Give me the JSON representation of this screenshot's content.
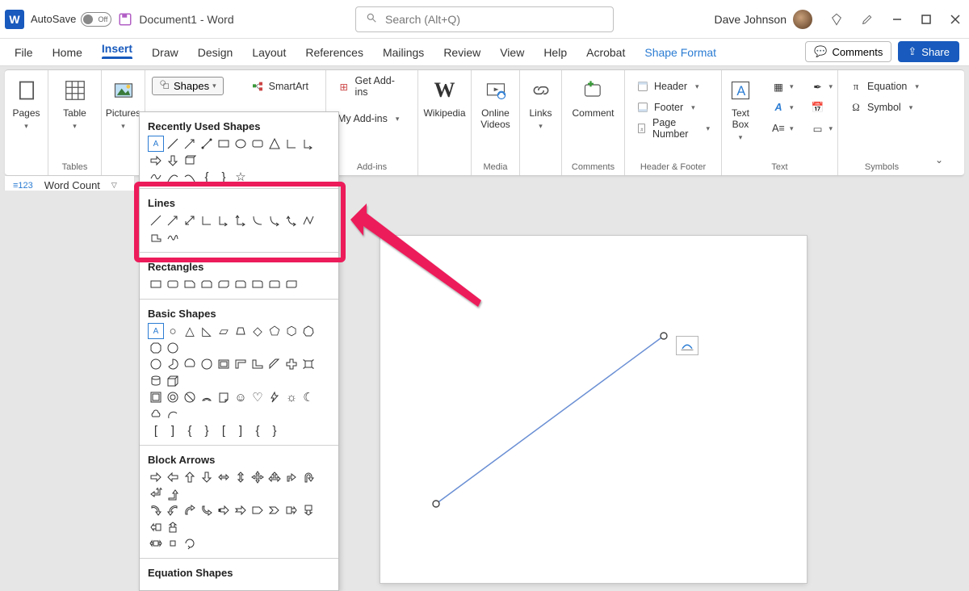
{
  "titlebar": {
    "autosave_label": "AutoSave",
    "autosave_state": "Off",
    "document_title": "Document1  -  Word",
    "search_placeholder": "Search (Alt+Q)",
    "user_name": "Dave Johnson"
  },
  "tabs": {
    "file": "File",
    "home": "Home",
    "insert": "Insert",
    "draw": "Draw",
    "design": "Design",
    "layout": "Layout",
    "references": "References",
    "mailings": "Mailings",
    "review": "Review",
    "view": "View",
    "help": "Help",
    "acrobat": "Acrobat",
    "shape_format": "Shape Format",
    "comments": "Comments",
    "share": "Share"
  },
  "ribbon": {
    "pages": "Pages",
    "table": "Table",
    "tables_group": "Tables",
    "pictures": "Pictures",
    "shapes": "Shapes",
    "smartart": "SmartArt",
    "get_addins": "Get Add-ins",
    "my_addins": "My Add-ins",
    "addins_group": "Add-ins",
    "wikipedia": "Wikipedia",
    "online_videos": "Online\nVideos",
    "media_group": "Media",
    "links": "Links",
    "comment": "Comment",
    "comments_group": "Comments",
    "header": "Header",
    "footer": "Footer",
    "page_number": "Page Number",
    "hf_group": "Header & Footer",
    "text_box": "Text\nBox",
    "text_group": "Text",
    "equation": "Equation",
    "symbol": "Symbol",
    "symbols_group": "Symbols"
  },
  "quickbar": {
    "word_count": "Word Count"
  },
  "shapes_panel": {
    "recently_used": "Recently Used Shapes",
    "lines": "Lines",
    "rectangles": "Rectangles",
    "basic_shapes": "Basic Shapes",
    "block_arrows": "Block Arrows",
    "equation_shapes": "Equation Shapes"
  }
}
